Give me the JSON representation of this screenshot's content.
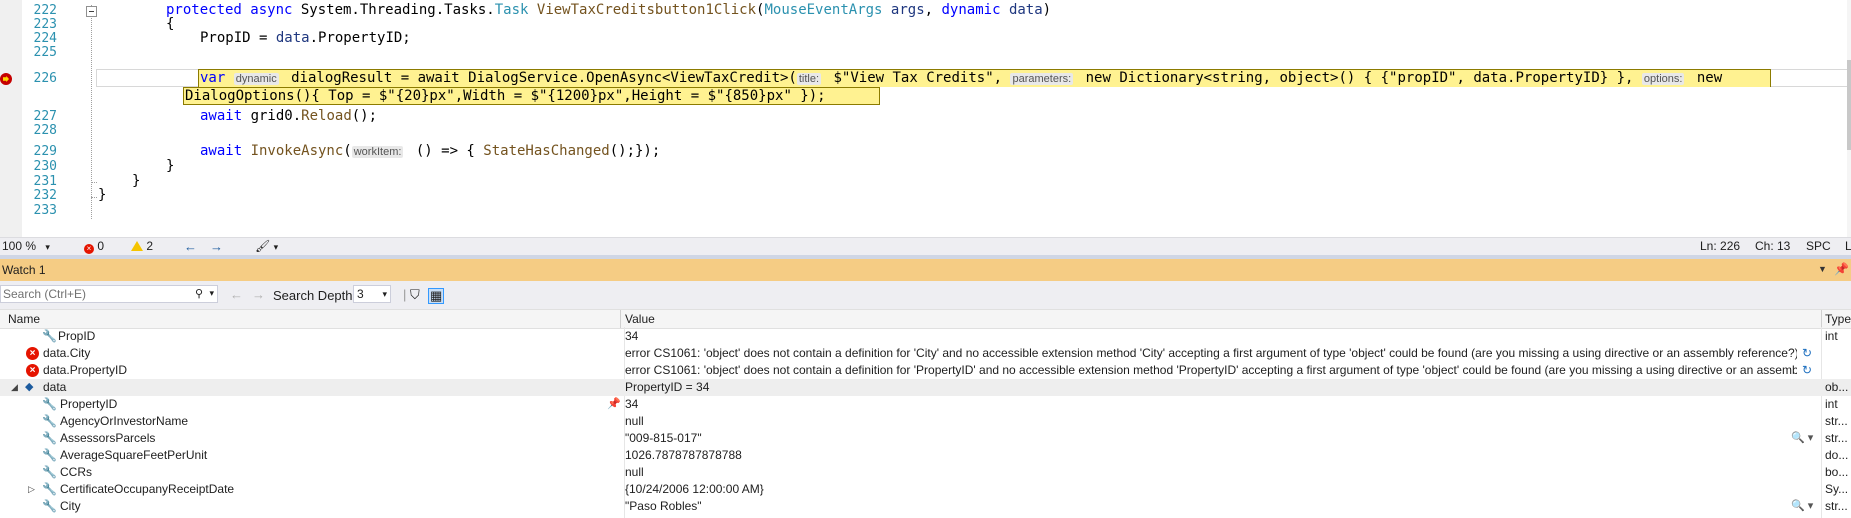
{
  "editor": {
    "line_numbers": [
      "222",
      "223",
      "224",
      "225",
      "226",
      "",
      "227",
      "228",
      "229",
      "230",
      "231",
      "232",
      "233"
    ],
    "lines": {
      "l222_a": "protected async ",
      "l222_b": "System.Threading.Tasks.",
      "l222_c": "Task ",
      "l222_d": "ViewTaxCreditsbutton1Click",
      "l222_e": "(",
      "l222_f": "MouseEventArgs ",
      "l222_g": "args",
      "l222_h": ", ",
      "l222_i": "dynamic ",
      "l222_j": "data",
      "l222_k": ")",
      "l223": "{",
      "l224_a": "PropID",
      "l224_b": " = ",
      "l224_c": "data",
      "l224_d": ".PropertyID;",
      "l226_var": "var",
      "l226_hint_type": "dynamic",
      "l226_a": " dialogResult = await DialogService.OpenAsync<ViewTaxCredit>(",
      "l226_hint_title": "title:",
      "l226_b": " $\"View Tax Credits\", ",
      "l226_hint_params": "parameters:",
      "l226_c": " new Dictionary<string, object>() { {\"propID\", data.PropertyID} }, ",
      "l226_hint_options": "options:",
      "l226_d": " new",
      "l226b": "DialogOptions(){ Top = $\"{20}px\",Width = $\"{1200}px\",Height = $\"{850}px\" });",
      "l227_a": "await ",
      "l227_b": "grid0",
      "l227_c": ".",
      "l227_d": "Reload",
      "l227_e": "();",
      "l229_a": "await ",
      "l229_b": "InvokeAsync",
      "l229_c": "(",
      "l229_hint": "workItem:",
      "l229_d": " () => { ",
      "l229_e": "StateHasChanged",
      "l229_f": "();});",
      "l230": "}",
      "l231": "}",
      "l232": "}"
    }
  },
  "status_bar": {
    "zoom": "100 %",
    "errors": "0",
    "warnings": "2",
    "position": "Ln: 226",
    "char": "Ch: 13",
    "mode": "SPC",
    "eol": "L"
  },
  "watch": {
    "title": "Watch 1",
    "search_placeholder": "Search (Ctrl+E)",
    "search_depth_label": "Search Depth:",
    "search_depth_value": "3",
    "columns": {
      "name": "Name",
      "value": "Value",
      "type": "Type"
    },
    "rows": [
      {
        "name": "PropID",
        "value": "34",
        "type": "int"
      },
      {
        "name": "data.City",
        "value": "error CS1061: 'object' does not contain a definition for 'City' and no accessible extension method 'City' accepting a first argument of type 'object' could be found (are you missing a using directive or an assembly reference?)",
        "type": ""
      },
      {
        "name": "data.PropertyID",
        "value": "error CS1061: 'object' does not contain a definition for 'PropertyID' and no accessible extension method 'PropertyID' accepting a first argument of type 'object' could be found (are you missing a using directive or an assemb...",
        "type": ""
      },
      {
        "name": "data",
        "value": "PropertyID = 34",
        "type": "ob..."
      },
      {
        "name": "PropertyID",
        "value": "34",
        "type": "int"
      },
      {
        "name": "AgencyOrInvestorName",
        "value": "null",
        "type": "str..."
      },
      {
        "name": "AssessorsParcels",
        "value": "\"009-815-017\"",
        "type": "str..."
      },
      {
        "name": "AverageSquareFeetPerUnit",
        "value": "1026.7878787878788",
        "type": "do..."
      },
      {
        "name": "CCRs",
        "value": "null",
        "type": "bo..."
      },
      {
        "name": "CertificateOccupanyReceiptDate",
        "value": "{10/24/2006 12:00:00 AM}",
        "type": "Sy..."
      },
      {
        "name": "City",
        "value": "\"Paso Robles\"",
        "type": "str..."
      }
    ]
  }
}
